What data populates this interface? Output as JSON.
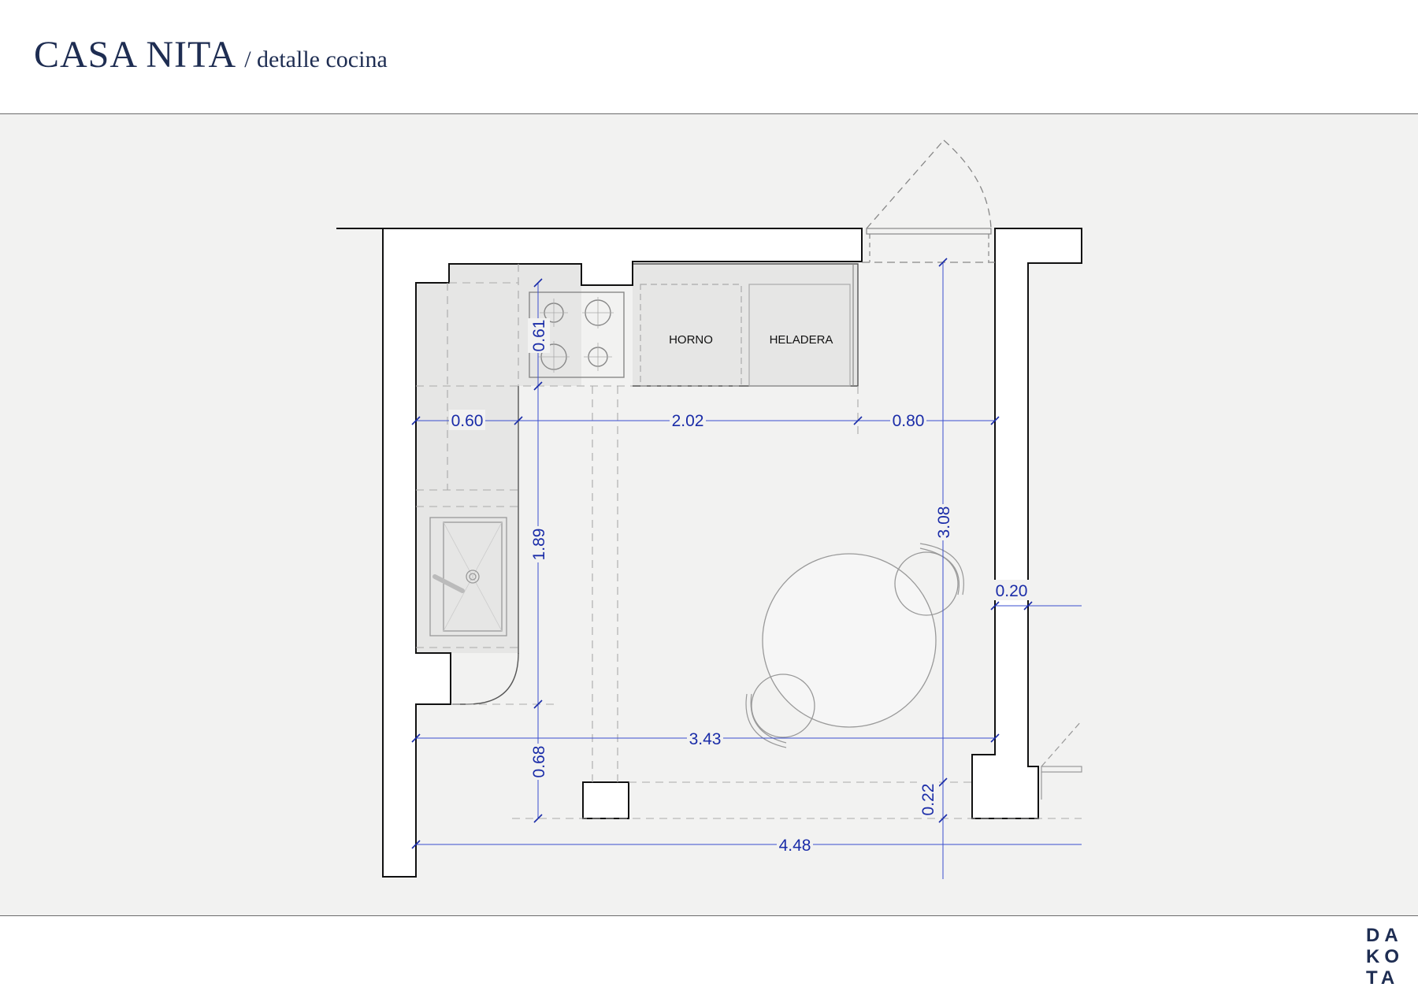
{
  "header": {
    "project_title": "CASA NITA",
    "subtitle": "/ detalle cocina"
  },
  "plan": {
    "appliances": {
      "oven": "HORNO",
      "fridge": "HELADERA"
    },
    "dimensions": {
      "counter_depth_left": "0.60",
      "counter_length_top": "2.02",
      "top_gap": "0.80",
      "cooktop_depth": "0.61",
      "left_counter_length": "1.89",
      "bottom_gap_left": "0.68",
      "inner_width": "3.43",
      "total_width": "4.48",
      "room_depth": "3.08",
      "wall_thickness": "0.20",
      "column_offset": "0.22"
    }
  },
  "logo": {
    "lines": [
      "DA",
      "KO",
      "TA"
    ]
  },
  "colors": {
    "title": "#1e2d52",
    "dimension": "#1a2ca8",
    "canvas": "#f2f2f1",
    "counter": "#e6e6e5"
  }
}
